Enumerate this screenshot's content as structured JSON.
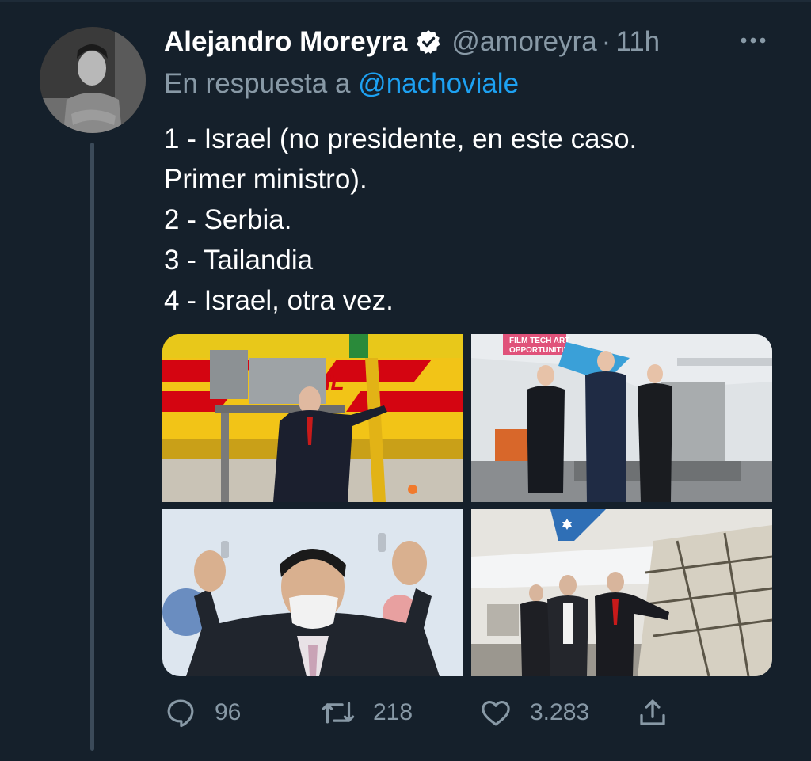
{
  "tweet": {
    "author_name": "Alejandro Moreyra",
    "author_handle": "@amoreyra",
    "separator": "·",
    "time": "11h",
    "reply_prefix": "En respuesta a",
    "reply_mention": "@nachoviale",
    "lines": [
      "1 - Israel (no presidente, en este caso.",
      "Primer ministro).",
      "2 - Serbia.",
      "3 - Tailandia",
      "4 - Israel, otra vez."
    ],
    "photo1_sign": "DHL",
    "photo2_banner": [
      "FILM TECH ART",
      "OPPORTUNITIES"
    ]
  },
  "actions": {
    "replies": "96",
    "retweets": "218",
    "likes": "3.283"
  },
  "icons": {
    "verified": "verified-badge-icon",
    "more": "more-dots-icon",
    "reply": "reply-bubble-icon",
    "retweet": "retweet-icon",
    "like": "heart-icon",
    "share": "share-icon"
  },
  "colors": {
    "background": "#15202b",
    "muted": "#8899a6",
    "link": "#1da1f2"
  }
}
